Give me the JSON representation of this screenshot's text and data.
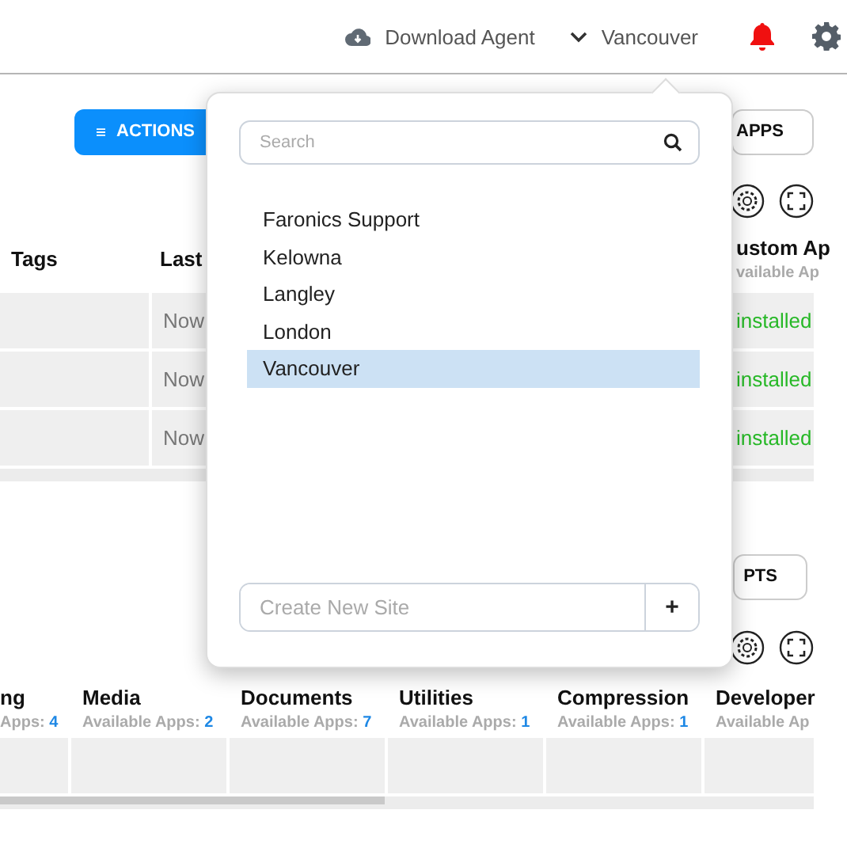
{
  "header": {
    "download": "Download Agent",
    "site": "Vancouver"
  },
  "apps_panel": {
    "actions": "ACTIONS",
    "dropdown": "APPS",
    "columns": [
      {
        "title": "Tags"
      },
      {
        "title": "Last"
      }
    ],
    "custom_column": {
      "title": "ustom Ap",
      "subtitle": "vailable Ap"
    },
    "rows": [
      {
        "last": "Now",
        "status": "installed"
      },
      {
        "last": "Now",
        "status": "installed"
      },
      {
        "last": "Now",
        "status": "installed"
      }
    ]
  },
  "categories_panel": {
    "dropdown": "PTS",
    "columns": [
      {
        "title": "ng",
        "label": "Apps:",
        "count": "4"
      },
      {
        "title": "Media",
        "label": "Available Apps:",
        "count": "2"
      },
      {
        "title": "Documents",
        "label": "Available Apps:",
        "count": "7"
      },
      {
        "title": "Utilities",
        "label": "Available Apps:",
        "count": "1"
      },
      {
        "title": "Compression",
        "label": "Available Apps:",
        "count": "1"
      },
      {
        "title": "Developer",
        "label": "Available Ap"
      }
    ]
  },
  "site_menu": {
    "search_placeholder": "Search",
    "sites": [
      {
        "name": "Faronics Support",
        "selected": false
      },
      {
        "name": "Kelowna",
        "selected": false
      },
      {
        "name": "Langley",
        "selected": false
      },
      {
        "name": "London",
        "selected": false
      },
      {
        "name": "Vancouver",
        "selected": true
      }
    ],
    "new_site_placeholder": "Create New Site",
    "add": "+"
  }
}
